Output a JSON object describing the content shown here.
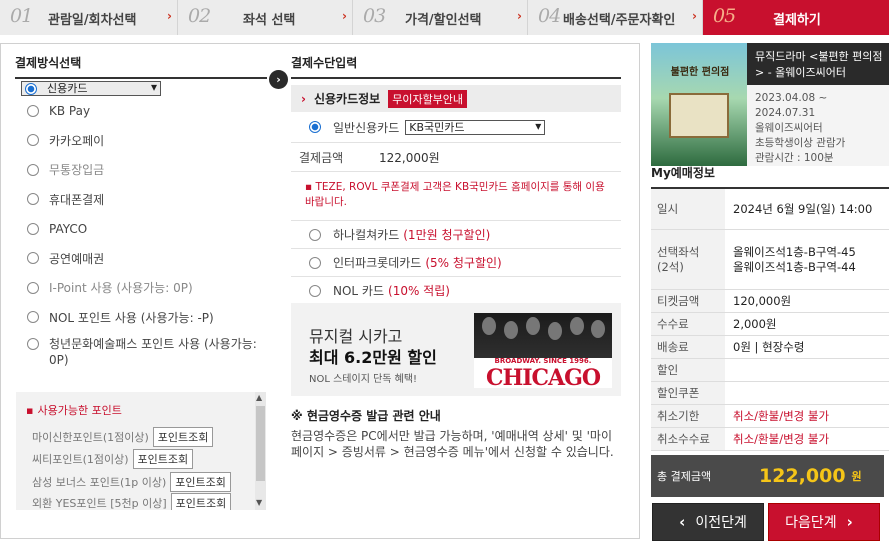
{
  "steps": [
    {
      "num": "01",
      "label": "관람일/회차선택"
    },
    {
      "num": "02",
      "label": "좌석 선택"
    },
    {
      "num": "03",
      "label": "가격/할인선택"
    },
    {
      "num": "04",
      "label": "배송선택/주문자확인"
    },
    {
      "num": "05",
      "label": "결제하기"
    }
  ],
  "payment_method": {
    "title": "결제방식선택",
    "options": [
      {
        "label": "신용카드",
        "selected": true
      },
      {
        "label": "KB Pay"
      },
      {
        "label": "카카오페이"
      },
      {
        "label": "무통장입금"
      },
      {
        "label": "휴대폰결제"
      },
      {
        "label": "PAYCO"
      },
      {
        "label": "공연예매권"
      },
      {
        "label": "I-Point 사용 (사용가능: 0P)"
      },
      {
        "label": "NOL 포인트 사용 (사용가능: -P)"
      },
      {
        "label": "청년문화예술패스 포인트 사용 (사용가능: 0P)"
      }
    ],
    "points_title": "사용가능한 포인트",
    "points": [
      {
        "label": "마이신한포인트(1점이상)",
        "button": "포인트조회"
      },
      {
        "label": "씨티포인트(1점이상)",
        "button": "포인트조회"
      },
      {
        "label": "삼성 보너스 포인트(1p 이상)",
        "button": "포인트조회"
      },
      {
        "label": "외환 YES포인트 [5천p 이상]",
        "button": "포인트조회"
      }
    ]
  },
  "payment_input": {
    "title": "결제수단입력",
    "card_header": "신용카드정보",
    "installment_badge": "무이자할부안내",
    "general_card_label": "일반신용카드",
    "card_select": "KB국민카드",
    "amount_label": "결제금액",
    "amount_value": "122,000원",
    "notice": "TEZE, ROVL 쿠폰결제 고객은 KB국민카드 홈페이지를 통해 이용바랍니다.",
    "card_options": [
      {
        "name": "하나컬쳐카드",
        "benefit": "(1만원 청구할인)"
      },
      {
        "name": "인터파크롯데카드",
        "benefit": "(5% 청구할인)"
      },
      {
        "name": "NOL 카드",
        "benefit": "(10% 적립)"
      }
    ]
  },
  "banner": {
    "line1": "뮤지컬 시카고",
    "line2": "최대 6.2만원 할인",
    "line3": "NOL 스테이지 단독 혜택!",
    "img_tag": "BROADWAY. SINCE 1996.",
    "img_title": "CHICAGO"
  },
  "cash_receipt": {
    "title": "※ 현금영수증 발급 관련 안내",
    "body": "현금영수증은 PC에서만 발급 가능하며, '예매내역 상세' 및 '마이페이지 > 증빙서류 > 현금영수증 메뉴'에서 신청할 수 있습니다."
  },
  "show": {
    "title": "뮤직드라마 <불편한 편의점> - 올웨이즈씨어터",
    "period": "2023.04.08 ~ 2024.07.31",
    "venue": "올웨이즈씨어터",
    "age": "초등학생이상 관람가",
    "runtime": "관람시간 : 100분",
    "poster_text": "불편한 편의점"
  },
  "my_booking": {
    "title": "My예매정보",
    "rows": [
      {
        "k": "일시",
        "v": "2024년 6월 9일(일) 14:00"
      },
      {
        "k": "선택좌석\n(2석)",
        "v": "올웨이즈석1층-B구역-45\n올웨이즈석1층-B구역-44"
      },
      {
        "k": "티켓금액",
        "v": "120,000원"
      },
      {
        "k": "수수료",
        "v": "2,000원"
      },
      {
        "k": "배송료",
        "v": "0원 | 현장수령"
      },
      {
        "k": "할인",
        "v": ""
      },
      {
        "k": "할인쿠폰",
        "v": ""
      },
      {
        "k": "취소기한",
        "v": "취소/환불/변경 불가",
        "red": true
      },
      {
        "k": "취소수수료",
        "v": "취소/환불/변경 불가",
        "red": true
      }
    ],
    "total_label": "총 결제금액",
    "total_value": "122,000",
    "total_unit": "원"
  },
  "buttons": {
    "prev": "이전단계",
    "next": "다음단계"
  }
}
